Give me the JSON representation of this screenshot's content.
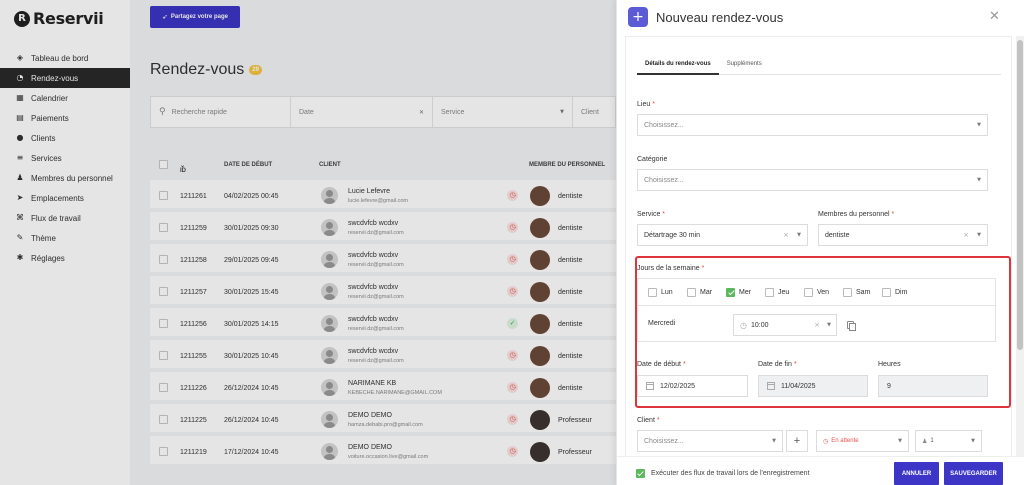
{
  "app": {
    "logo_letter": "R",
    "logo_text": "Reservii"
  },
  "sidebar": {
    "items": [
      {
        "label": "Tableau de bord",
        "icon": "layers-icon",
        "glyph": "◈"
      },
      {
        "label": "Rendez-vous",
        "icon": "clock-icon",
        "glyph": "◔",
        "active": true
      },
      {
        "label": "Calendrier",
        "icon": "calendar-icon",
        "glyph": "▦"
      },
      {
        "label": "Paiements",
        "icon": "wallet-icon",
        "glyph": "▤"
      },
      {
        "label": "Clients",
        "icon": "users-icon",
        "glyph": "●"
      },
      {
        "label": "Services",
        "icon": "list-icon",
        "glyph": "≡"
      },
      {
        "label": "Membres du personnel",
        "icon": "user-icon",
        "glyph": "♟"
      },
      {
        "label": "Emplacements",
        "icon": "location-icon",
        "glyph": "➤"
      },
      {
        "label": "Flux de travail",
        "icon": "workflow-icon",
        "glyph": "⌘"
      },
      {
        "label": "Thème",
        "icon": "brush-icon",
        "glyph": "✎"
      },
      {
        "label": "Réglages",
        "icon": "gear-icon",
        "glyph": "✱"
      }
    ]
  },
  "main": {
    "share_label": "Partagez votre page",
    "title": "Rendez-vous",
    "count": "29",
    "filters": {
      "search_placeholder": "Recherche rapide",
      "date": "Date",
      "service": "Service",
      "client": "Client"
    },
    "columns": {
      "id": "ID",
      "date": "DATE DE DÉBUT",
      "client": "CLIENT",
      "staff": "MEMBRE DU PERSONNEL"
    },
    "rows": [
      {
        "id": "1211261",
        "date": "04/02/2025 00:45",
        "name": "Lucie Lefevre",
        "email": "lucie.lefevre@gmail.com",
        "status": "pending",
        "staff": "dentiste"
      },
      {
        "id": "1211259",
        "date": "30/01/2025 09:30",
        "name": "swcdvfcb wcdxv",
        "email": "reservii.dz@gmail.com",
        "status": "pending",
        "staff": "dentiste"
      },
      {
        "id": "1211258",
        "date": "29/01/2025 09:45",
        "name": "swcdvfcb wcdxv",
        "email": "reservii.dz@gmail.com",
        "status": "pending",
        "staff": "dentiste"
      },
      {
        "id": "1211257",
        "date": "30/01/2025 15:45",
        "name": "swcdvfcb wcdxv",
        "email": "reservii.dz@gmail.com",
        "status": "pending",
        "staff": "dentiste"
      },
      {
        "id": "1211256",
        "date": "30/01/2025 14:15",
        "name": "swcdvfcb wcdxv",
        "email": "reservii.dz@gmail.com",
        "status": "approved",
        "staff": "dentiste"
      },
      {
        "id": "1211255",
        "date": "30/01/2025 10:45",
        "name": "swcdvfcb wcdxv",
        "email": "reservii.dz@gmail.com",
        "status": "pending",
        "staff": "dentiste"
      },
      {
        "id": "1211226",
        "date": "26/12/2024 10:45",
        "name": "NARIMANE KB",
        "email": "KEBECHE.NARIMANE@GMAIL.COM",
        "status": "pending",
        "staff": "dentiste"
      },
      {
        "id": "1211225",
        "date": "26/12/2024 10:45",
        "name": "DEMO DEMO",
        "email": "hamza.debabi.pro@gmail.com",
        "status": "pending",
        "staff": "Professeur"
      },
      {
        "id": "1211219",
        "date": "17/12/2024 10:45",
        "name": "DEMO DEMO",
        "email": "voiture.occasion.live@gmail.com",
        "status": "pending",
        "staff": "Professeur"
      }
    ]
  },
  "modal": {
    "title": "Nouveau rendez-vous",
    "tabs": [
      "Détails du rendez-vous",
      "Suppléments"
    ],
    "lieu_label": "Lieu",
    "lieu_placeholder": "Choisissez...",
    "categorie_label": "Catégorie",
    "categorie_placeholder": "Choisissez...",
    "service_label": "Service",
    "service_value": "Détartrage 30 min",
    "staff_label": "Membres du personnel",
    "staff_value": "dentiste",
    "days_label": "Jours de la semaine",
    "days": [
      {
        "label": "Lun",
        "checked": false
      },
      {
        "label": "Mar",
        "checked": false
      },
      {
        "label": "Mer",
        "checked": true
      },
      {
        "label": "Jeu",
        "checked": false
      },
      {
        "label": "Ven",
        "checked": false
      },
      {
        "label": "Sam",
        "checked": false
      },
      {
        "label": "Dim",
        "checked": false
      }
    ],
    "day_name": "Mercredi",
    "day_time": "10:00",
    "start_label": "Date de début",
    "start_value": "12/02/2025",
    "end_label": "Date de fin",
    "end_value": "11/04/2025",
    "hours_label": "Heures",
    "hours_value": "9",
    "client_label": "Client",
    "client_placeholder": "Choisissez...",
    "status_value": "En attente",
    "count_value": "1",
    "workflow_label": "Exécuter des flux de travail lors de l'enregistrement",
    "cancel_label": "ANNULER",
    "save_label": "SAUVEGARDER"
  },
  "colors": {
    "accent": "#3c35c6",
    "highlight": "#e0343c",
    "check": "#5bb85b",
    "badge": "#f5c542"
  }
}
